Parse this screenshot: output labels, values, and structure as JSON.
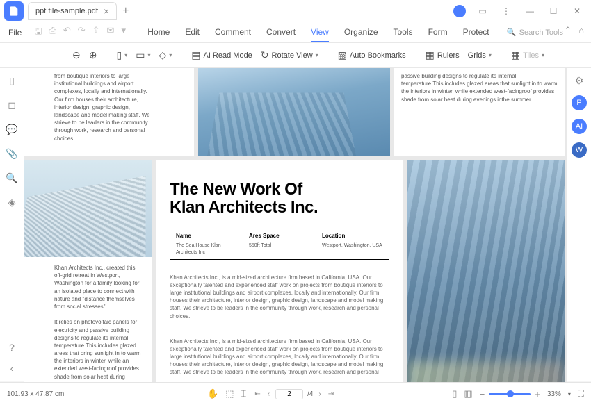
{
  "titlebar": {
    "tab_title": "ppt file-sample.pdf"
  },
  "menubar": {
    "file": "File",
    "tabs": [
      "Home",
      "Edit",
      "Comment",
      "Convert",
      "View",
      "Organize",
      "Tools",
      "Form",
      "Protect"
    ],
    "active_index": 4,
    "search_placeholder": "Search Tools"
  },
  "toolbar": {
    "ai_read_mode": "AI Read Mode",
    "rotate_view": "Rotate View",
    "auto_bookmarks": "Auto Bookmarks",
    "rulers": "Rulers",
    "grids": "Grids",
    "tiles": "Tiles"
  },
  "doc": {
    "top_left": "from boutique interiors to large institutional buildings and airport complexes, locally and internationally. Our firm houses their architecture, interior design, graphic design, landscape and model making staff. We strieve to be leaders in the community through work, research and personal choices.",
    "top_right": "passive building designs to regulate its internal temperature.This includes glazed areas that sunlight in to warm the interiors in winter, while extended west-facingroof provides shade from solar heat during evenings inthe summer.",
    "title_line1": "The New Work Of",
    "title_line2": "Klan Architects Inc.",
    "table": {
      "name_lbl": "Name",
      "name_val": "The Sea House Klan Architects Inc",
      "area_lbl": "Ares Space",
      "area_val": "550ft Total",
      "loc_lbl": "Location",
      "loc_val": "Westport, Washington, USA"
    },
    "left_para1": "Khan Architects Inc., created this off-grid retreat in Westport, Washington for a family looking for an isolated place to connect with nature and \"distance themselves from social stresses\".",
    "left_para2": "It relies on photovoltaic panels for electricity and passive building designs to regulate its internal temperature.This includes glazed areas that bring sunlight in to warm the interiors in winter, while an extended west-facingroof provides shade from solar heat during evenings inthe summer.",
    "body1": "Khan Architects Inc., is a mid-sized architecture firm based in California, USA. Our exceptionally talented and experienced staff work on projects from boutique interiors to large institutional buildings and airport complexes, locally and internationally. Our firm houses their architecture, interior design, graphic design, landscape and model making staff. We strieve to be leaders in the community through work, research and personal choices.",
    "body2": "Khan Architects Inc., is a mid-sized architecture firm based in California, USA. Our exceptionally talented and experienced staff work on projects from boutique interiors to large institutional buildings and airport complexes, locally and internationally. Our firm houses their architecture, interior design, graphic design, landscape and model making staff. We strieve to be leaders in the community through work, research and personal"
  },
  "statusbar": {
    "dimensions": "101.93 x 47.87 cm",
    "page_current": "2",
    "page_total": "/4",
    "zoom": "33%"
  }
}
